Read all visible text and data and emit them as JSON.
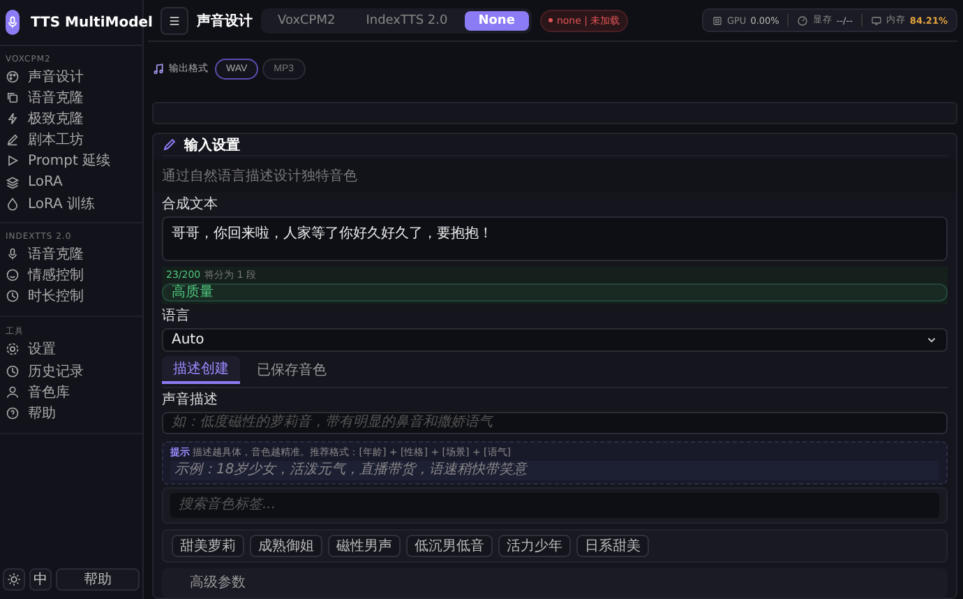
{
  "app": {
    "title": "TTS MultiModel"
  },
  "sidebar": {
    "sections": [
      {
        "heading": "VOXCPM2",
        "items": [
          {
            "label": "声音设计",
            "selected": false
          },
          {
            "label": "语音克隆",
            "selected": false
          },
          {
            "label": "极致克隆",
            "selected": false
          },
          {
            "label": "剧本工坊",
            "selected": false
          },
          {
            "label": "Prompt 延续",
            "selected": false
          },
          {
            "label": "LoRA",
            "selected": false
          },
          {
            "label": "LoRA 训练",
            "selected": false
          }
        ]
      },
      {
        "heading": "INDEXTTS 2.0",
        "items": [
          {
            "label": "语音克隆",
            "selected": false
          },
          {
            "label": "情感控制",
            "selected": false
          },
          {
            "label": "时长控制",
            "selected": false
          }
        ]
      },
      {
        "heading": "工具",
        "items": [
          {
            "label": "设置",
            "selected": false
          },
          {
            "label": "历史记录",
            "selected": false
          },
          {
            "label": "音色库",
            "selected": false
          },
          {
            "label": "帮助",
            "selected": false
          }
        ]
      }
    ],
    "footer": {
      "language": "中",
      "help": "帮助"
    }
  },
  "header": {
    "page_title": "声音设计",
    "models": [
      {
        "label": "VoxCPM2",
        "selected": false
      },
      {
        "label": "IndexTTS 2.0",
        "selected": false
      },
      {
        "label": "None",
        "selected": true
      }
    ],
    "status": "none | 未加载",
    "stats": [
      {
        "label": "GPU",
        "value": "0.00%",
        "highlight": false
      },
      {
        "label": "显存",
        "value": "--/--",
        "highlight": false
      },
      {
        "label": "内存",
        "value": "84.21%",
        "highlight": true
      }
    ]
  },
  "output_format": {
    "label": "输出格式",
    "options": [
      {
        "label": "WAV",
        "selected": true
      },
      {
        "label": "MP3",
        "selected": false
      }
    ]
  },
  "card": {
    "title": "输入设置",
    "subtitle": "通过自然语言描述设计独特音色",
    "text_label": "合成文本",
    "text_value": "哥哥，你回来啦，人家等了你好久好久了，要抱抱！",
    "count": "23/200",
    "segments": "将分为 1 段",
    "quality_tag": "高质量",
    "language_label": "语言",
    "language_value": "Auto",
    "tabs": [
      {
        "label": "描述创建",
        "selected": true
      },
      {
        "label": "已保存音色",
        "selected": false
      }
    ],
    "description_label": "声音描述",
    "description_placeholder": "如：低度磁性的萝莉音，带有明显的鼻音和撒娇语气",
    "hint_title": "提示",
    "hint_text": "描述越具体，音色越精准。推荐格式：[年龄] + [性格] + [场景] + [语气]",
    "example": "示例：18岁少女，活泼元气，直播带货，语速稍快带笑意",
    "search_placeholder": "搜索音色标签...",
    "presets": [
      "甜美萝莉",
      "成熟御姐",
      "磁性男声",
      "低沉男低音",
      "活力少年",
      "日系甜美"
    ],
    "advanced": "高级参数"
  }
}
